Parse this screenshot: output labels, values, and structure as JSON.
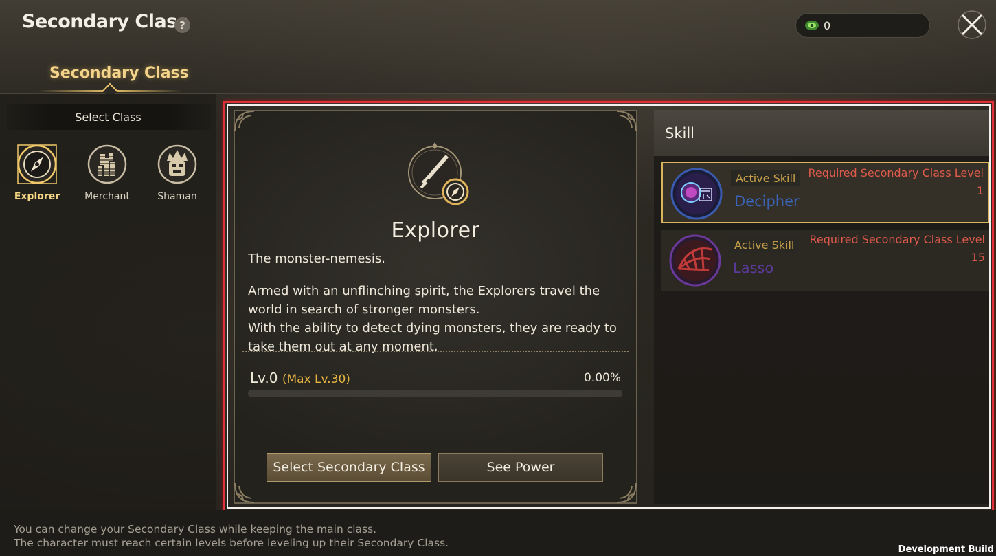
{
  "header": {
    "title": "Secondary Class",
    "help_icon": "?",
    "currency_value": "0",
    "tab_label": "Secondary Class"
  },
  "sidebar": {
    "heading": "Select Class",
    "classes": [
      {
        "label": "Explorer",
        "icon": "compass-icon",
        "selected": true
      },
      {
        "label": "Merchant",
        "icon": "coin-stack-icon",
        "selected": false
      },
      {
        "label": "Shaman",
        "icon": "totem-mask-icon",
        "selected": false
      }
    ]
  },
  "detail": {
    "class_name": "Explorer",
    "tagline": "The monster-nemesis.",
    "description_1": "Armed with an unflinching spirit, the Explorers travel the world in search of stronger monsters.",
    "description_2": "With the ability to detect dying monsters, they are ready to take them out at any moment.",
    "level": "Lv.0",
    "max_level": "(Max Lv.30)",
    "progress_text": "0.00%",
    "progress_fraction": 0,
    "select_button": "Select Secondary Class",
    "power_button": "See Power"
  },
  "skills": {
    "heading": "Skill",
    "items": [
      {
        "badge": "Active Skill",
        "name": "Decipher",
        "name_color": "#3a64b8",
        "req_label": "Required Secondary Class Level",
        "req_value": "1",
        "icon": "decipher-skill-icon",
        "selected": true
      },
      {
        "badge": "Active Skill",
        "name": "Lasso",
        "name_color": "#5a3a98",
        "req_label": "Required Secondary Class Level",
        "req_value": "15",
        "icon": "lasso-skill-icon",
        "selected": false
      }
    ]
  },
  "footer": {
    "line1": "You can change your Secondary Class while keeping the main class.",
    "line2": "The character must reach certain levels before leveling up their Secondary Class.",
    "dev_build": "Development Build"
  },
  "colors": {
    "accent_gold": "#e8b640",
    "highlight_red": "#e0303a",
    "requirement_red": "#e05a4c"
  }
}
